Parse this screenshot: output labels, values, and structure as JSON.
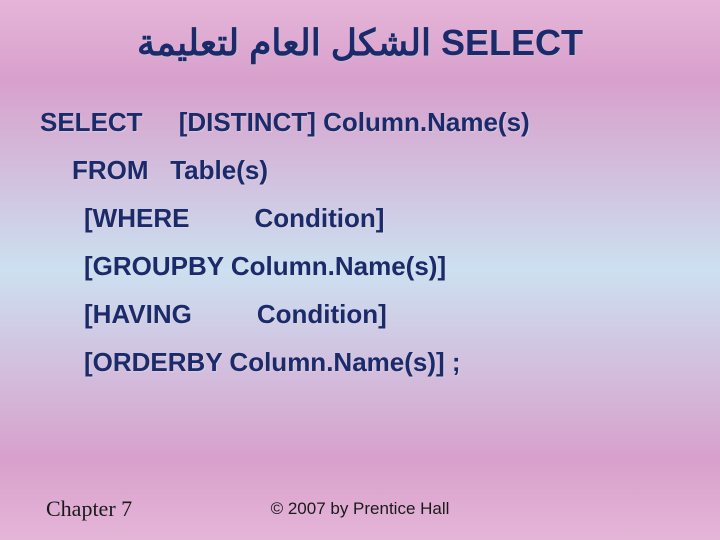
{
  "title": {
    "arabic": "الشكل العام لتعليمة",
    "keyword": "SELECT"
  },
  "syntax": {
    "select_kw": "SELECT",
    "select_rest": "[DISTINCT] Column.Name(s)",
    "from_kw": "FROM",
    "from_rest": "Table(s)",
    "where_kw": "[WHERE",
    "where_rest": "Condition]",
    "groupby": "[GROUPBY Column.Name(s)]",
    "having_kw": "[HAVING",
    "having_rest": "Condition]",
    "orderby": "[ORDERBY Column.Name(s)]  ;"
  },
  "footer": {
    "chapter": "Chapter 7",
    "copyright": "© 2007 by Prentice Hall"
  }
}
